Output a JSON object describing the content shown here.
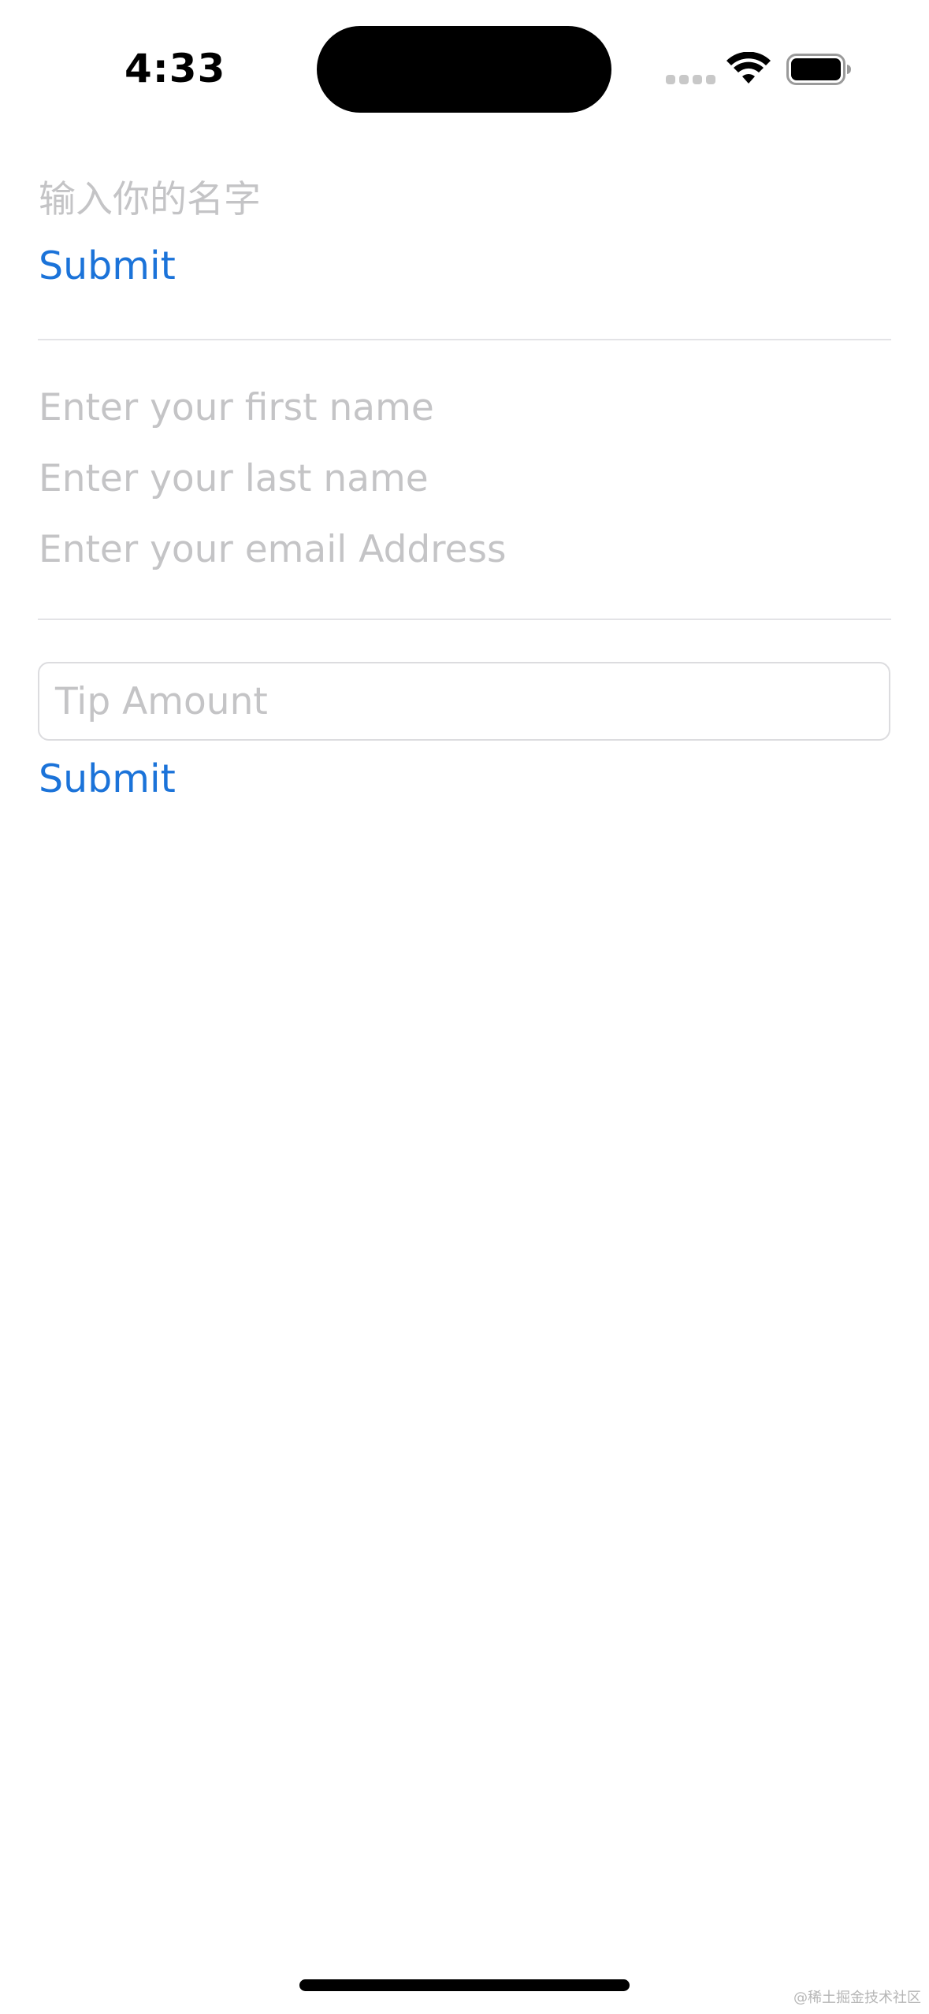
{
  "status_bar": {
    "time": "4:33"
  },
  "form_cn": {
    "name_placeholder": "输入你的名字",
    "submit_label": "Submit"
  },
  "form_person": {
    "first_name_placeholder": "Enter your first name",
    "last_name_placeholder": "Enter your last name",
    "email_placeholder": "Enter your email Address"
  },
  "form_tip": {
    "tip_placeholder": "Tip Amount",
    "submit_label": "Submit"
  },
  "colors": {
    "accent": "#1b73d9",
    "placeholder": "#c4c4c6",
    "divider": "#e3e3e6"
  },
  "icons": [
    "signal-icon",
    "wifi-icon",
    "battery-icon"
  ],
  "watermark": "@稀土掘金技术社区"
}
